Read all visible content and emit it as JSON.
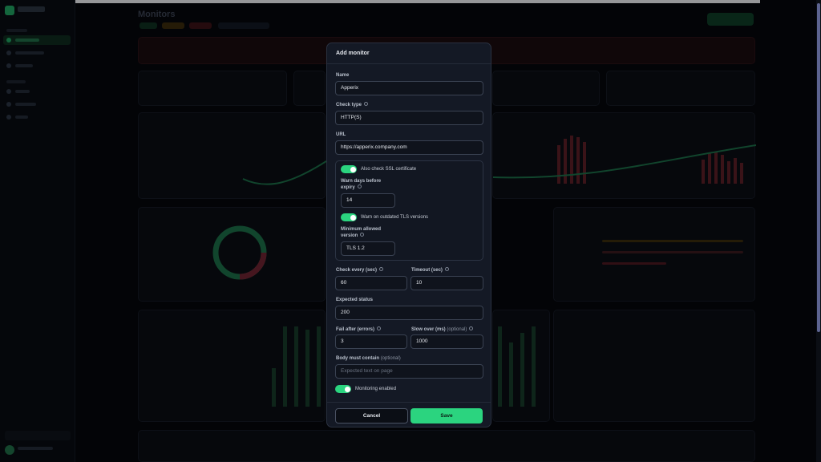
{
  "modal": {
    "title": "Add monitor",
    "name_label": "Name",
    "name_value": "Apperix",
    "check_type_label": "Check type",
    "check_type_value": "HTTP(S)",
    "url_label": "URL",
    "url_value": "https://apperix.company.com",
    "ssl": {
      "check_ssl_label": "Also check SSL certificate",
      "warn_days_label_1": "Warn days before",
      "warn_days_label_2": "expiry",
      "warn_days_value": "14",
      "tls_label": "Warn on outdated TLS versions",
      "min_version_label_1": "Minimum allowed",
      "min_version_label_2": "version",
      "min_version_value": "TLS 1.2"
    },
    "check_every_label": "Check every (sec)",
    "check_every_value": "60",
    "timeout_label": "Timeout (sec)",
    "timeout_value": "10",
    "expected_status_label": "Expected status",
    "expected_status_value": "200",
    "fail_after_label": "Fail after (errors)",
    "fail_after_value": "3",
    "slow_over_label": "Slow over (ms)",
    "slow_over_optional": "(optional)",
    "slow_over_value": "1000",
    "body_label": "Body must contain",
    "body_optional": "(optional)",
    "body_placeholder": "Expected text on page",
    "monitoring_label": "Monitoring enabled",
    "cancel_label": "Cancel",
    "save_label": "Save"
  },
  "background": {
    "page_title": "Monitors"
  },
  "colors": {
    "accent": "#2bd47f",
    "modal_bg": "#141925",
    "page_bg": "#05070b"
  }
}
